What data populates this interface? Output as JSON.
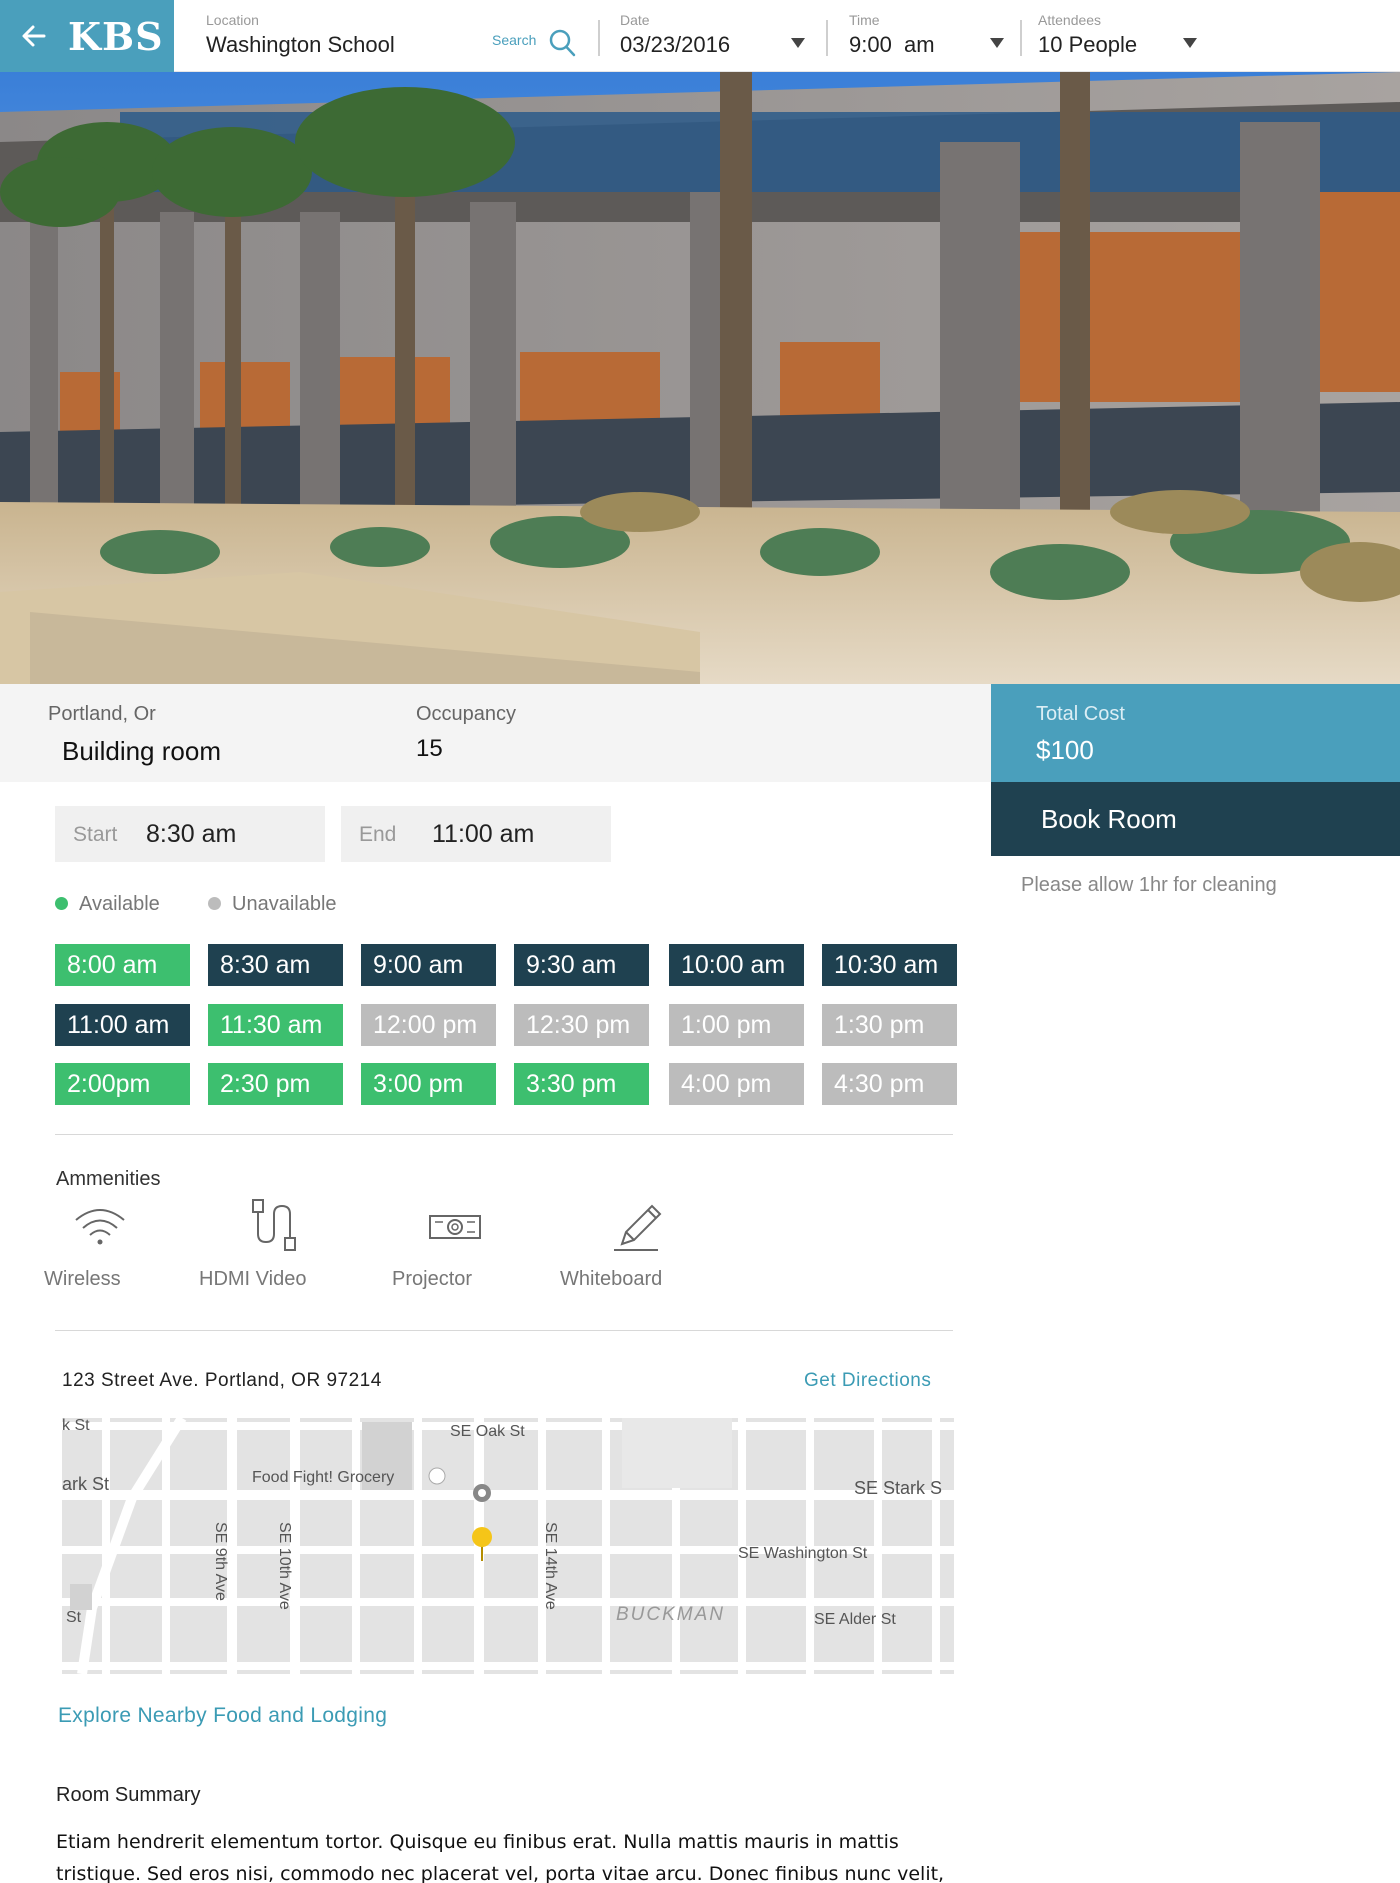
{
  "header": {
    "logo": "KBS",
    "location": {
      "label": "Location",
      "value": "Washington School"
    },
    "search_label": "Search",
    "date": {
      "label": "Date",
      "value": "03/23/2016"
    },
    "time": {
      "label": "Time",
      "value": "9:00  am"
    },
    "attendees": {
      "label": "Attendees",
      "value": "10 People"
    }
  },
  "room": {
    "city": "Portland, Or",
    "name": "Building room",
    "occupancy_label": "Occupancy",
    "occupancy": "15"
  },
  "booking": {
    "total_label": "Total Cost",
    "total": "$100",
    "book_label": "Book Room",
    "note": "Please allow 1hr for cleaning",
    "start_label": "Start",
    "start": "8:30 am",
    "end_label": "End",
    "end": "11:00 am"
  },
  "legend": {
    "available": "Available",
    "unavailable": "Unavailable",
    "available_color": "#3dbf6f",
    "booked_color": "#1f4150",
    "unavailable_color": "#bcbcbc"
  },
  "slots": [
    {
      "label": "8:00 am",
      "status": "available"
    },
    {
      "label": "8:30 am",
      "status": "booked"
    },
    {
      "label": "9:00 am",
      "status": "booked"
    },
    {
      "label": "9:30 am",
      "status": "booked"
    },
    {
      "label": "10:00 am",
      "status": "booked"
    },
    {
      "label": "10:30 am",
      "status": "booked"
    },
    {
      "label": "11:00 am",
      "status": "booked"
    },
    {
      "label": "11:30 am",
      "status": "available"
    },
    {
      "label": "12:00 pm",
      "status": "unavailable"
    },
    {
      "label": "12:30 pm",
      "status": "unavailable"
    },
    {
      "label": "1:00 pm",
      "status": "unavailable"
    },
    {
      "label": "1:30 pm",
      "status": "unavailable"
    },
    {
      "label": "2:00pm",
      "status": "available"
    },
    {
      "label": "2:30 pm",
      "status": "available"
    },
    {
      "label": "3:00 pm",
      "status": "available"
    },
    {
      "label": "3:30 pm",
      "status": "available"
    },
    {
      "label": "4:00 pm",
      "status": "unavailable"
    },
    {
      "label": "4:30 pm",
      "status": "unavailable"
    }
  ],
  "amenities": {
    "title": "Ammenities",
    "items": [
      {
        "label": "Wireless",
        "icon": "wifi-icon"
      },
      {
        "label": "HDMI Video",
        "icon": "hdmi-cable-icon"
      },
      {
        "label": "Projector",
        "icon": "projector-icon"
      },
      {
        "label": "Whiteboard",
        "icon": "pencil-icon"
      }
    ]
  },
  "location": {
    "address": "123 Street Ave. Portland, OR 97214",
    "directions_label": "Get Directions",
    "map_labels": {
      "oak": "SE Oak St",
      "grocery": "Food Fight! Grocery",
      "stark_left": "ark St",
      "stark_right": "SE Stark S",
      "washington": "SE Washington St",
      "alder": "SE Alder St",
      "ninth": "SE 9th Ave",
      "tenth": "SE 10th Ave",
      "fourteenth": "SE 14th Ave",
      "buckman": "BUCKMAN",
      "k_st": "k St",
      "st": "St"
    },
    "explore_label": "Explore Nearby Food and Lodging"
  },
  "summary": {
    "title": "Room Summary",
    "text": "Etiam hendrerit elementum tortor. Quisque eu finibus erat. Nulla mattis mauris in mattis tristique. Sed eros nisi, commodo nec placerat vel, porta vitae arcu. Donec finibus nunc velit,"
  }
}
